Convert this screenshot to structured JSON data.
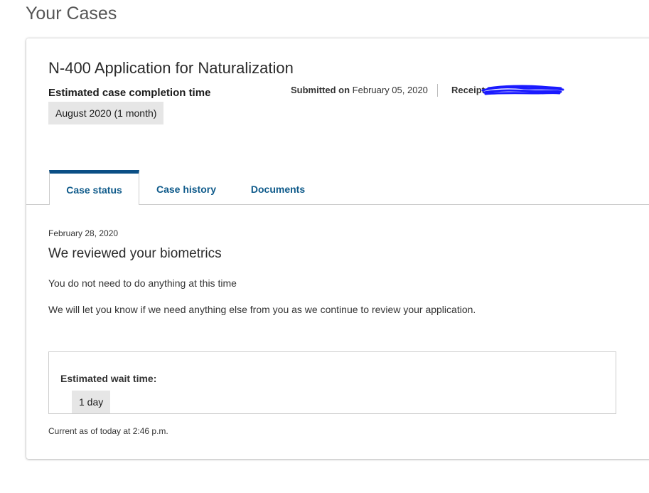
{
  "page": {
    "heading": "Your Cases"
  },
  "case": {
    "title": "N-400 Application for Naturalization",
    "completion_label": "Estimated case completion time",
    "completion_value": "August 2020 (1 month)",
    "submitted_label": "Submitted on",
    "submitted_date": "February 05, 2020",
    "receipt_label": "Receipt"
  },
  "tabs": [
    {
      "label": "Case status",
      "active": true
    },
    {
      "label": "Case history",
      "active": false
    },
    {
      "label": "Documents",
      "active": false
    }
  ],
  "status": {
    "date": "February 28, 2020",
    "title": "We reviewed your biometrics",
    "line1": "You do not need to do anything at this time",
    "line2": "We will let you know if we need anything else from you as we continue to review your application."
  },
  "wait": {
    "label": "Estimated wait time:",
    "value": "1 day"
  },
  "footer": {
    "current_as_of": "Current as of today at 2:46 p.m."
  },
  "colors": {
    "tab_accent": "#0b4f85",
    "tab_text": "#0e5a8a",
    "redaction": "#1a1aff"
  },
  "icons": {
    "redaction": "redaction-scribble"
  }
}
